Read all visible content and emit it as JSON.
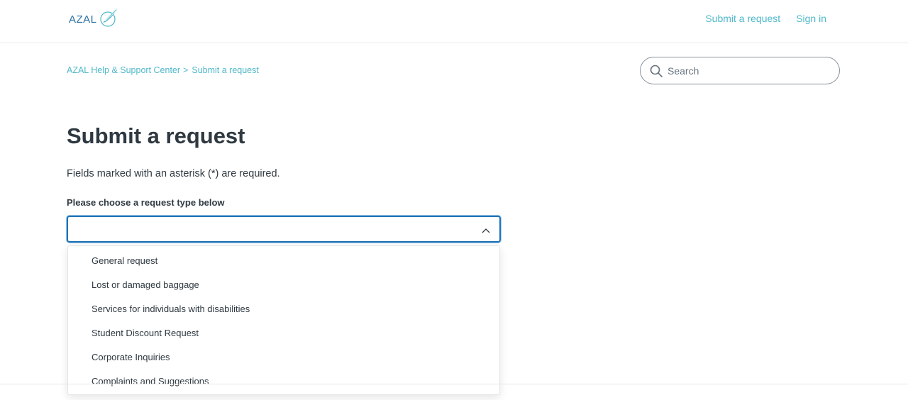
{
  "header": {
    "logo_text": "AZAL",
    "nav": {
      "submit_request": "Submit a request",
      "sign_in": "Sign in"
    }
  },
  "breadcrumb": {
    "home": "AZAL Help & Support Center",
    "separator": ">",
    "current": "Submit a request"
  },
  "search": {
    "placeholder": "Search",
    "icon": "search-icon"
  },
  "main": {
    "title": "Submit a request",
    "required_note": "Fields marked with an asterisk (*) are required.",
    "request_type": {
      "label": "Please choose a request type below",
      "value": "",
      "icon": "chevron-up-icon",
      "options": [
        "General request",
        "Lost or damaged baggage",
        "Services for individuals with disabilities",
        "Student Discount Request",
        "Corporate Inquiries",
        "Complaints and Suggestions"
      ]
    }
  },
  "colors": {
    "accent_link": "#4fb8c9",
    "focus_border": "#1f73b7",
    "text": "#2f3941",
    "logo": "#2a6e9f"
  }
}
